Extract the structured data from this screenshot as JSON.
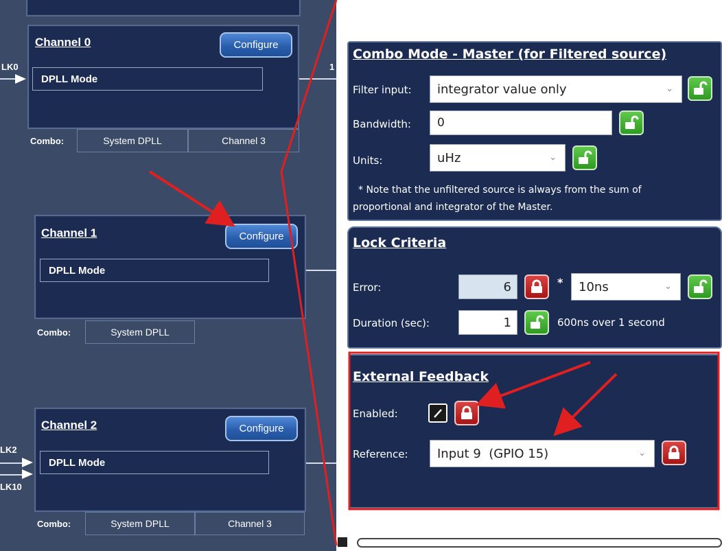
{
  "channels": [
    {
      "title": "Channel 0",
      "configure": "Configure",
      "mode": "DPLL Mode",
      "combo_label": "Combo:",
      "combo": [
        "System DPLL",
        "Channel 3"
      ]
    },
    {
      "title": "Channel 1",
      "configure": "Configure",
      "mode": "DPLL Mode",
      "combo_label": "Combo:",
      "combo": [
        "System DPLL"
      ]
    },
    {
      "title": "Channel 2",
      "configure": "Configure",
      "mode": "DPLL Mode",
      "combo_label": "Combo:",
      "combo": [
        "System DPLL",
        "Channel 3"
      ]
    }
  ],
  "pins": {
    "lk0": "LK0",
    "lk2": "LK2",
    "lk10": "LK10",
    "out1": "1"
  },
  "combo_master": {
    "title": "Combo Mode - Master (for Filtered source)",
    "filter_input_label": "Filter input:",
    "filter_input_value": "integrator value only",
    "bandwidth_label": "Bandwidth:",
    "bandwidth_value": "0",
    "units_label": "Units:",
    "units_value": "uHz",
    "note_line1": "* Note that the unfiltered source is always from the sum of",
    "note_line2": "proportional and integrator of the Master."
  },
  "lock_criteria": {
    "title": "Lock Criteria",
    "error_label": "Error:",
    "error_value": "6",
    "multiplier": "*",
    "error_unit": "10ns",
    "duration_label": "Duration (sec):",
    "duration_value": "1",
    "duration_summary": "600ns over 1 second"
  },
  "external_feedback": {
    "title": "External Feedback",
    "enabled_label": "Enabled:",
    "enabled": true,
    "reference_label": "Reference:",
    "reference_value": "Input 9  (GPIO 15)"
  },
  "colors": {
    "panel_bg": "#1b2b52",
    "canvas_bg": "#3a4a67",
    "lock_green": "#3fae2f",
    "lock_red": "#c02525",
    "annotation_red": "#e02020"
  },
  "icons": [
    "unlocked-padlock-icon",
    "locked-padlock-icon",
    "chevron-down-icon",
    "checkmark-icon",
    "arrow-right-icon"
  ]
}
